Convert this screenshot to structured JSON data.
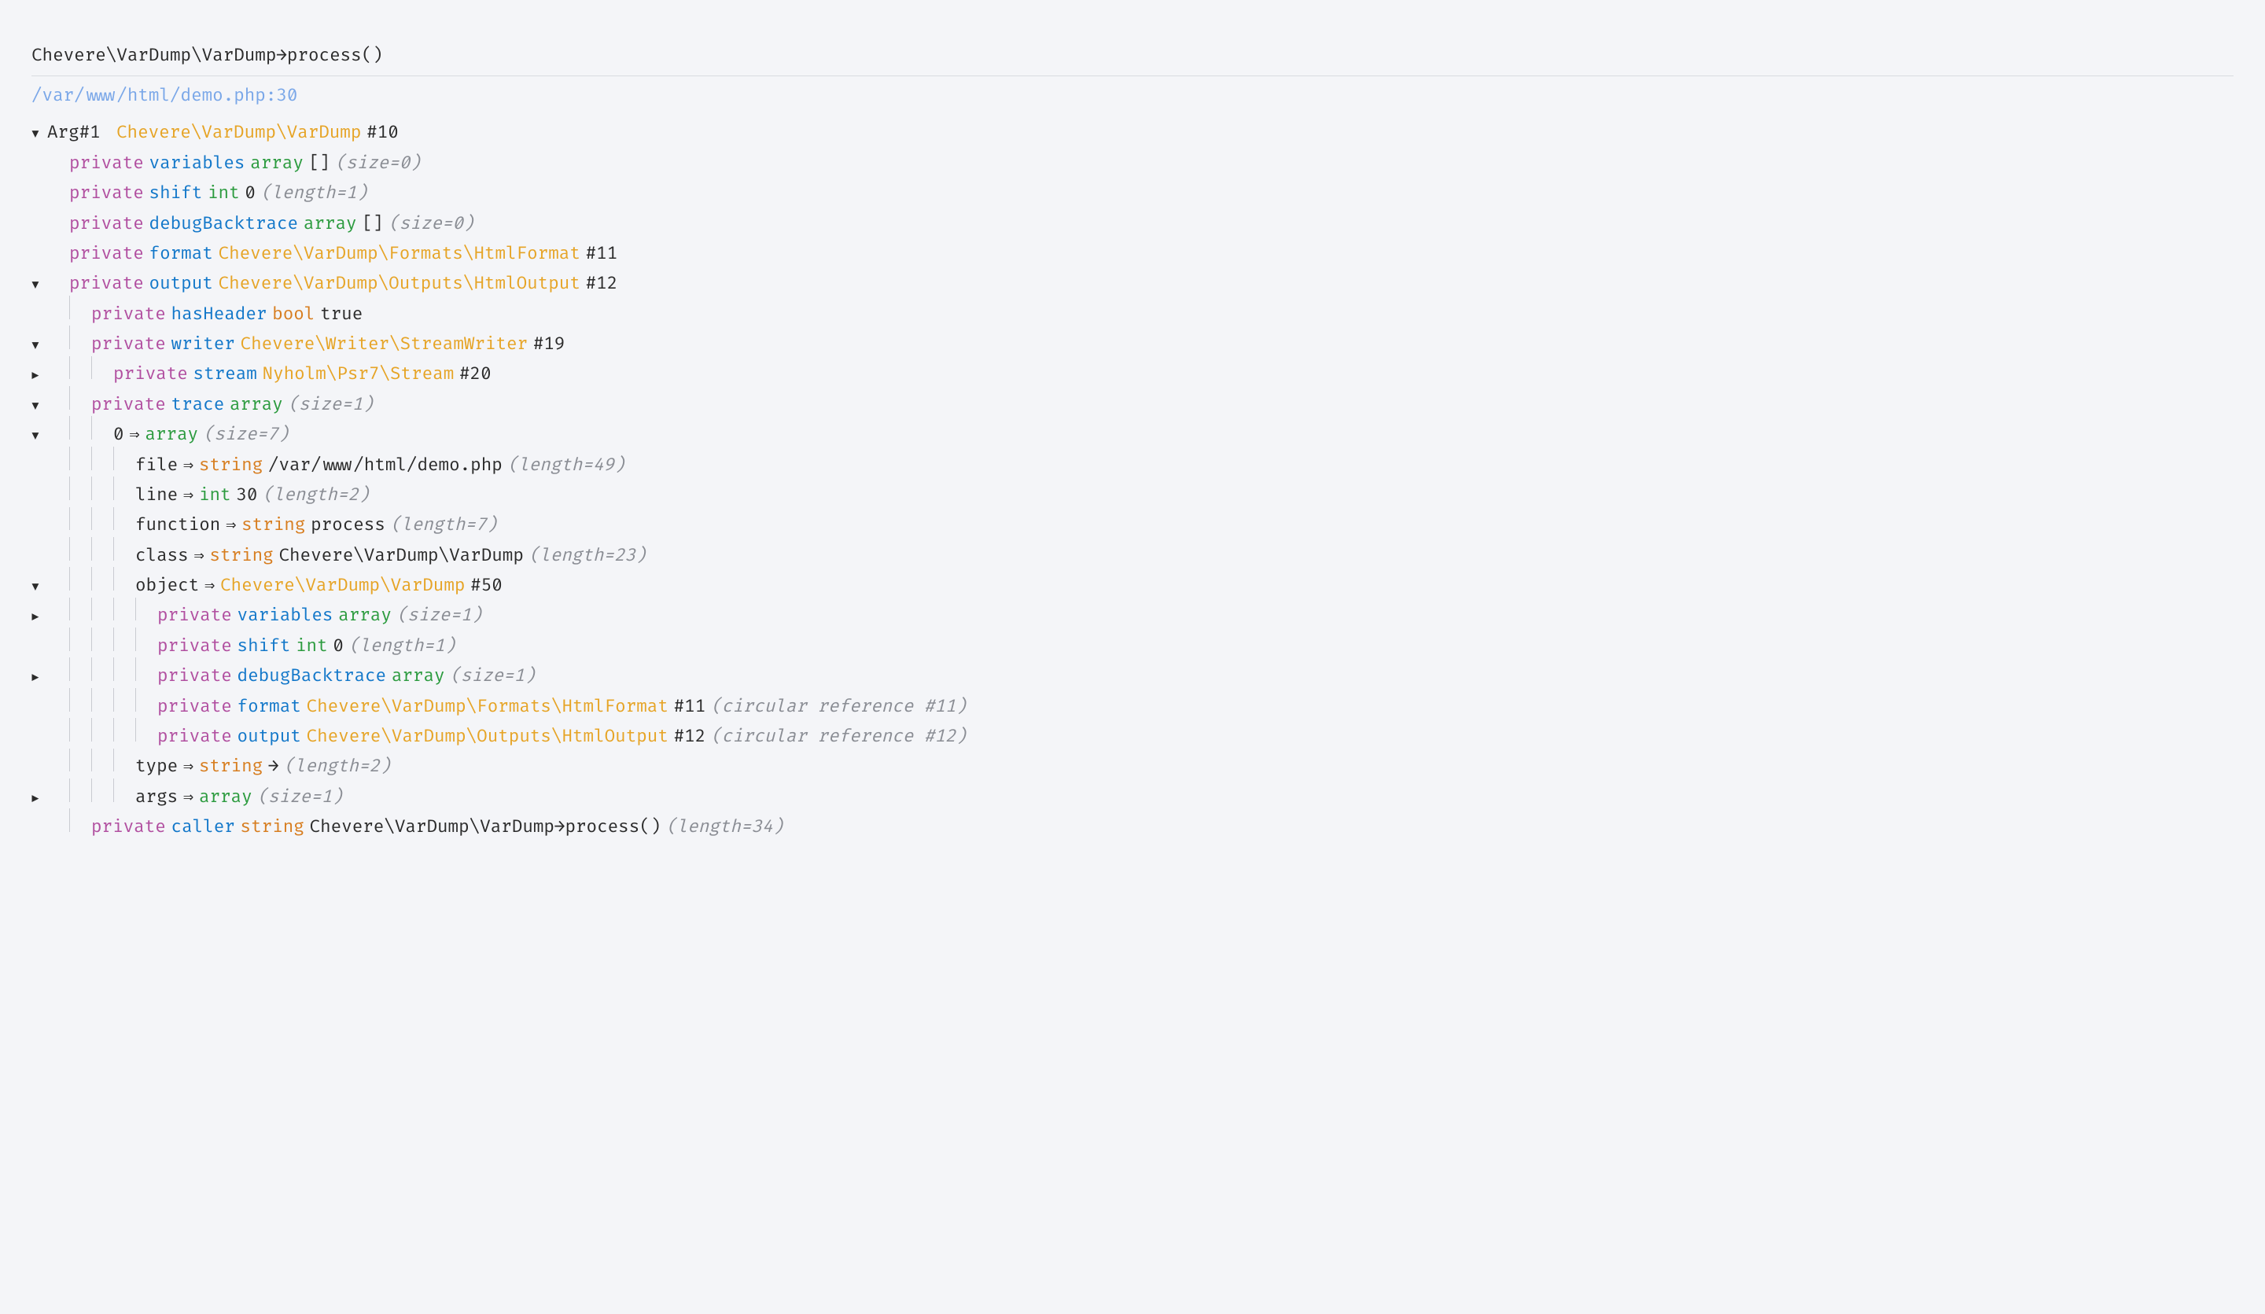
{
  "header": "Chevere\\VarDump\\VarDump→process()",
  "filepath": "/var/www/html/demo.php:30",
  "icons": {
    "down": "▼",
    "right": "▶"
  },
  "lines": [
    {
      "toggle": "down",
      "indent": 0,
      "pipes": "",
      "tokens": [
        {
          "t": "Arg#1 ",
          "c": "c-plain"
        },
        {
          "t": "Chevere\\VarDump\\VarDump",
          "c": "c-class"
        },
        {
          "t": "#10",
          "c": "c-plain"
        }
      ]
    },
    {
      "toggle": "",
      "indent": 1,
      "pipes": " ",
      "tokens": [
        {
          "t": "private",
          "c": "c-mod"
        },
        {
          "t": "variables",
          "c": "c-name"
        },
        {
          "t": "array",
          "c": "c-type"
        },
        {
          "t": "[]",
          "c": "c-plain"
        },
        {
          "t": "(size=0)",
          "c": "c-dim"
        }
      ]
    },
    {
      "toggle": "",
      "indent": 1,
      "pipes": " ",
      "tokens": [
        {
          "t": "private",
          "c": "c-mod"
        },
        {
          "t": "shift",
          "c": "c-name"
        },
        {
          "t": "int",
          "c": "c-type"
        },
        {
          "t": "0",
          "c": "c-num"
        },
        {
          "t": "(length=1)",
          "c": "c-dim"
        }
      ]
    },
    {
      "toggle": "",
      "indent": 1,
      "pipes": " ",
      "tokens": [
        {
          "t": "private",
          "c": "c-mod"
        },
        {
          "t": "debugBacktrace",
          "c": "c-name"
        },
        {
          "t": "array",
          "c": "c-type"
        },
        {
          "t": "[]",
          "c": "c-plain"
        },
        {
          "t": "(size=0)",
          "c": "c-dim"
        }
      ]
    },
    {
      "toggle": "",
      "indent": 1,
      "pipes": " ",
      "tokens": [
        {
          "t": "private",
          "c": "c-mod"
        },
        {
          "t": "format",
          "c": "c-name"
        },
        {
          "t": "Chevere\\VarDump\\Formats\\HtmlFormat",
          "c": "c-class"
        },
        {
          "t": "#11",
          "c": "c-plain"
        }
      ]
    },
    {
      "toggle": "down",
      "indent": 1,
      "pipes": " ",
      "tokens": [
        {
          "t": "private",
          "c": "c-mod"
        },
        {
          "t": "output",
          "c": "c-name"
        },
        {
          "t": "Chevere\\VarDump\\Outputs\\HtmlOutput",
          "c": "c-class"
        },
        {
          "t": "#12",
          "c": "c-plain"
        }
      ]
    },
    {
      "toggle": "",
      "indent": 2,
      "pipes": " |",
      "tokens": [
        {
          "t": "private",
          "c": "c-mod"
        },
        {
          "t": "hasHeader",
          "c": "c-name"
        },
        {
          "t": "bool",
          "c": "c-str"
        },
        {
          "t": "true",
          "c": "c-val"
        }
      ]
    },
    {
      "toggle": "down",
      "indent": 2,
      "pipes": " |",
      "tokens": [
        {
          "t": "private",
          "c": "c-mod"
        },
        {
          "t": "writer",
          "c": "c-name"
        },
        {
          "t": "Chevere\\Writer\\StreamWriter",
          "c": "c-class"
        },
        {
          "t": "#19",
          "c": "c-plain"
        }
      ]
    },
    {
      "toggle": "right",
      "indent": 3,
      "pipes": " ||",
      "tokens": [
        {
          "t": "private",
          "c": "c-mod"
        },
        {
          "t": "stream",
          "c": "c-name"
        },
        {
          "t": "Nyholm\\Psr7\\Stream",
          "c": "c-class"
        },
        {
          "t": "#20",
          "c": "c-plain"
        }
      ]
    },
    {
      "toggle": "down",
      "indent": 2,
      "pipes": " |",
      "tokens": [
        {
          "t": "private",
          "c": "c-mod"
        },
        {
          "t": "trace",
          "c": "c-name"
        },
        {
          "t": "array",
          "c": "c-type"
        },
        {
          "t": "(size=1)",
          "c": "c-dim"
        }
      ]
    },
    {
      "toggle": "down",
      "indent": 3,
      "pipes": " ||",
      "tokens": [
        {
          "t": "0",
          "c": "c-plain"
        },
        {
          "t": "⇒",
          "c": "c-op"
        },
        {
          "t": "array",
          "c": "c-type"
        },
        {
          "t": "(size=7)",
          "c": "c-dim"
        }
      ]
    },
    {
      "toggle": "",
      "indent": 4,
      "pipes": " |||",
      "tokens": [
        {
          "t": "file",
          "c": "c-plain"
        },
        {
          "t": "⇒",
          "c": "c-op"
        },
        {
          "t": "string",
          "c": "c-str"
        },
        {
          "t": "/var/www/html/demo.php",
          "c": "c-val"
        },
        {
          "t": "(length=49)",
          "c": "c-dim"
        }
      ]
    },
    {
      "toggle": "",
      "indent": 4,
      "pipes": " |||",
      "tokens": [
        {
          "t": "line",
          "c": "c-plain"
        },
        {
          "t": "⇒",
          "c": "c-op"
        },
        {
          "t": "int",
          "c": "c-type"
        },
        {
          "t": "30",
          "c": "c-num"
        },
        {
          "t": "(length=2)",
          "c": "c-dim"
        }
      ]
    },
    {
      "toggle": "",
      "indent": 4,
      "pipes": " |||",
      "tokens": [
        {
          "t": "function",
          "c": "c-plain"
        },
        {
          "t": "⇒",
          "c": "c-op"
        },
        {
          "t": "string",
          "c": "c-str"
        },
        {
          "t": "process",
          "c": "c-val"
        },
        {
          "t": "(length=7)",
          "c": "c-dim"
        }
      ]
    },
    {
      "toggle": "",
      "indent": 4,
      "pipes": " |||",
      "tokens": [
        {
          "t": "class",
          "c": "c-plain"
        },
        {
          "t": "⇒",
          "c": "c-op"
        },
        {
          "t": "string",
          "c": "c-str"
        },
        {
          "t": "Chevere\\VarDump\\VarDump",
          "c": "c-val"
        },
        {
          "t": "(length=23)",
          "c": "c-dim"
        }
      ]
    },
    {
      "toggle": "down",
      "indent": 4,
      "pipes": " |||",
      "tokens": [
        {
          "t": "object",
          "c": "c-plain"
        },
        {
          "t": "⇒",
          "c": "c-op"
        },
        {
          "t": "Chevere\\VarDump\\VarDump",
          "c": "c-class"
        },
        {
          "t": "#50",
          "c": "c-plain"
        }
      ]
    },
    {
      "toggle": "right",
      "indent": 5,
      "pipes": " ||||",
      "tokens": [
        {
          "t": "private",
          "c": "c-mod"
        },
        {
          "t": "variables",
          "c": "c-name"
        },
        {
          "t": "array",
          "c": "c-type"
        },
        {
          "t": "(size=1)",
          "c": "c-dim"
        }
      ]
    },
    {
      "toggle": "",
      "indent": 5,
      "pipes": " ||||",
      "tokens": [
        {
          "t": "private",
          "c": "c-mod"
        },
        {
          "t": "shift",
          "c": "c-name"
        },
        {
          "t": "int",
          "c": "c-type"
        },
        {
          "t": "0",
          "c": "c-num"
        },
        {
          "t": "(length=1)",
          "c": "c-dim"
        }
      ]
    },
    {
      "toggle": "right",
      "indent": 5,
      "pipes": " ||||",
      "tokens": [
        {
          "t": "private",
          "c": "c-mod"
        },
        {
          "t": "debugBacktrace",
          "c": "c-name"
        },
        {
          "t": "array",
          "c": "c-type"
        },
        {
          "t": "(size=1)",
          "c": "c-dim"
        }
      ]
    },
    {
      "toggle": "",
      "indent": 5,
      "pipes": " ||||",
      "tokens": [
        {
          "t": "private",
          "c": "c-mod"
        },
        {
          "t": "format",
          "c": "c-name"
        },
        {
          "t": "Chevere\\VarDump\\Formats\\HtmlFormat",
          "c": "c-class"
        },
        {
          "t": "#11",
          "c": "c-plain"
        },
        {
          "t": "(circular reference #11)",
          "c": "c-dim"
        }
      ]
    },
    {
      "toggle": "",
      "indent": 5,
      "pipes": " ||||",
      "tokens": [
        {
          "t": "private",
          "c": "c-mod"
        },
        {
          "t": "output",
          "c": "c-name"
        },
        {
          "t": "Chevere\\VarDump\\Outputs\\HtmlOutput",
          "c": "c-class"
        },
        {
          "t": "#12",
          "c": "c-plain"
        },
        {
          "t": "(circular reference #12)",
          "c": "c-dim"
        }
      ]
    },
    {
      "toggle": "",
      "indent": 4,
      "pipes": " |||",
      "tokens": [
        {
          "t": "type",
          "c": "c-plain"
        },
        {
          "t": "⇒",
          "c": "c-op"
        },
        {
          "t": "string",
          "c": "c-str"
        },
        {
          "t": "→",
          "c": "c-val"
        },
        {
          "t": "(length=2)",
          "c": "c-dim"
        }
      ]
    },
    {
      "toggle": "right",
      "indent": 4,
      "pipes": " |||",
      "tokens": [
        {
          "t": "args",
          "c": "c-plain"
        },
        {
          "t": "⇒",
          "c": "c-op"
        },
        {
          "t": "array",
          "c": "c-type"
        },
        {
          "t": "(size=1)",
          "c": "c-dim"
        }
      ]
    },
    {
      "toggle": "",
      "indent": 2,
      "pipes": " |",
      "tokens": [
        {
          "t": "private",
          "c": "c-mod"
        },
        {
          "t": "caller",
          "c": "c-name"
        },
        {
          "t": "string",
          "c": "c-str"
        },
        {
          "t": "Chevere\\VarDump\\VarDump→process()",
          "c": "c-val"
        },
        {
          "t": "(length=34)",
          "c": "c-dim"
        }
      ]
    }
  ]
}
